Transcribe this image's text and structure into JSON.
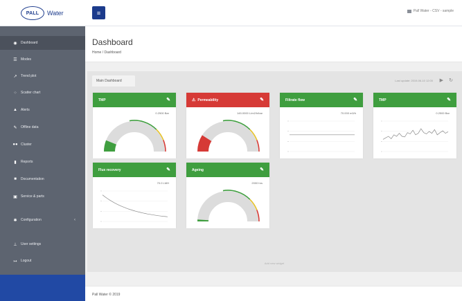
{
  "header": {
    "brand_logo_text": "PALL",
    "brand_sub": "Water",
    "user_text": "Pall Water - CSV - sample"
  },
  "sidebar": {
    "items": [
      {
        "label": "Dashboard",
        "icon": "dashboard-icon"
      },
      {
        "label": "Modes",
        "icon": "list-icon"
      },
      {
        "label": "Trend plot",
        "icon": "trend-icon"
      },
      {
        "label": "Scatter chart",
        "icon": "scatter-icon"
      },
      {
        "label": "Alerts",
        "icon": "alert-icon"
      },
      {
        "label": "Offline data",
        "icon": "pencil-icon"
      },
      {
        "label": "Cluster",
        "icon": "cluster-icon"
      },
      {
        "label": "Reports",
        "icon": "report-icon"
      },
      {
        "label": "Documentation",
        "icon": "book-icon"
      },
      {
        "label": "Service & parts",
        "icon": "service-icon"
      },
      {
        "label": "Configuration",
        "icon": "gear-icon"
      },
      {
        "label": "User settings",
        "icon": "user-icon"
      },
      {
        "label": "Logout",
        "icon": "logout-icon"
      }
    ]
  },
  "page": {
    "title": "Dashboard",
    "breadcrumb": "Home  /  Dashboard"
  },
  "main": {
    "tab_label": "Main Dashboard",
    "last_update": "Last update: 2019-06-10 12:00",
    "empty_note": "Add new widget"
  },
  "widgets": [
    {
      "title": "TMP",
      "value": "0.2500 Bar",
      "color": "#3f9e3f",
      "kind": "gauge",
      "level": 0.12,
      "alert": false
    },
    {
      "title": "Permeability",
      "value": "145.0000 L/m2/h/bar",
      "color": "#d63a36",
      "kind": "gauge",
      "level": 0.18,
      "alert": true
    },
    {
      "title": "Filtrate flow",
      "value": "70.000 m3/h",
      "color": "#3f9e3f",
      "kind": "flat-line",
      "alert": false
    },
    {
      "title": "TMP",
      "value": "0.2500 Bar",
      "color": "#3f9e3f",
      "kind": "noisy-line",
      "alert": false
    },
    {
      "title": "Flux recovery",
      "value": "70.0 LMH",
      "color": "#3f9e3f",
      "kind": "decay-line",
      "alert": false
    },
    {
      "title": "Ageing",
      "value": "2000 hrs",
      "color": "#3f9e3f",
      "kind": "gauge",
      "level": 0.02,
      "alert": false
    }
  ],
  "footer": {
    "text": "Pall Water © 2019"
  }
}
